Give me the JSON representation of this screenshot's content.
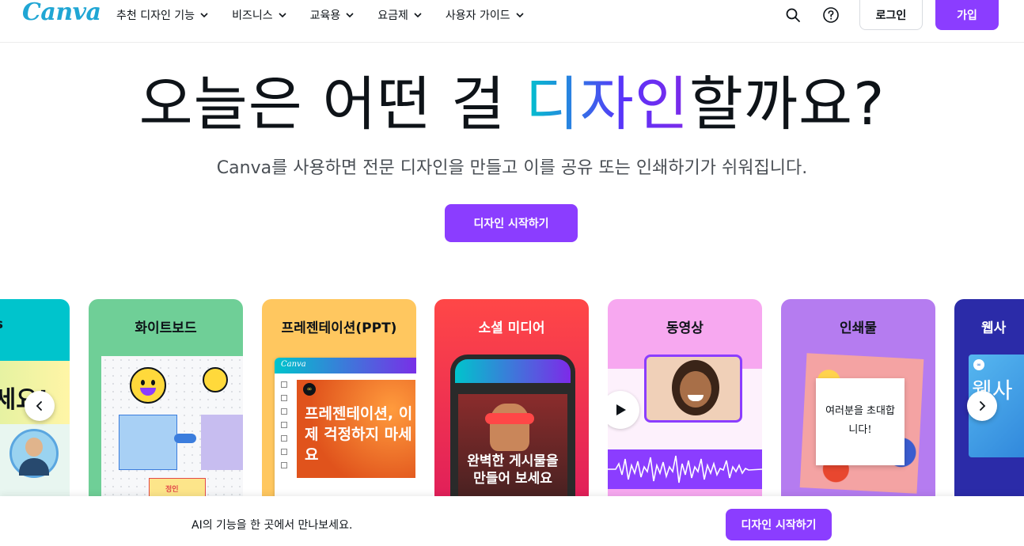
{
  "header": {
    "logo": "Canva",
    "nav": [
      {
        "label": "추천 디자인 기능"
      },
      {
        "label": "비즈니스"
      },
      {
        "label": "교육용"
      },
      {
        "label": "요금제"
      },
      {
        "label": "사용자 가이드"
      }
    ],
    "login_label": "로그인",
    "signup_label": "가입"
  },
  "hero": {
    "title_before": "오늘은 어떤 걸 ",
    "title_highlight": "디자인",
    "title_after": "할까요?",
    "subtitle": "Canva를 사용하면 전문 디자인을 만들고 이를 공유 또는 인쇄하기가 쉬워집니다.",
    "cta_label": "디자인 시작하기"
  },
  "carousel": {
    "cards": [
      {
        "title": "cs",
        "art_text": "하세요!",
        "color": "#00c4cc"
      },
      {
        "title": "화이트보드",
        "art_text": "정인",
        "color": "#6fcf97"
      },
      {
        "title": "프레젠테이션(PPT)",
        "app_label": "Canva",
        "art_text": "프레젠테이션, 이제 걱정하지 마세요",
        "color": "#ffc75f"
      },
      {
        "title": "소셜 미디어",
        "art_text": "완벽한 게시물을 만들어 보세요",
        "color": "#ff4747"
      },
      {
        "title": "동영상",
        "color": "#f7a8f0"
      },
      {
        "title": "인쇄물",
        "art_text": "여러분을 초대합니다!",
        "color": "#b57cf0"
      },
      {
        "title": "웹사",
        "art_text": "웹사",
        "color": "#2b2ba8"
      }
    ]
  },
  "bottom_bar": {
    "text": "AI의 기능을 한 곳에서 만나보세요.",
    "cta_label": "디자인 시작하기"
  }
}
